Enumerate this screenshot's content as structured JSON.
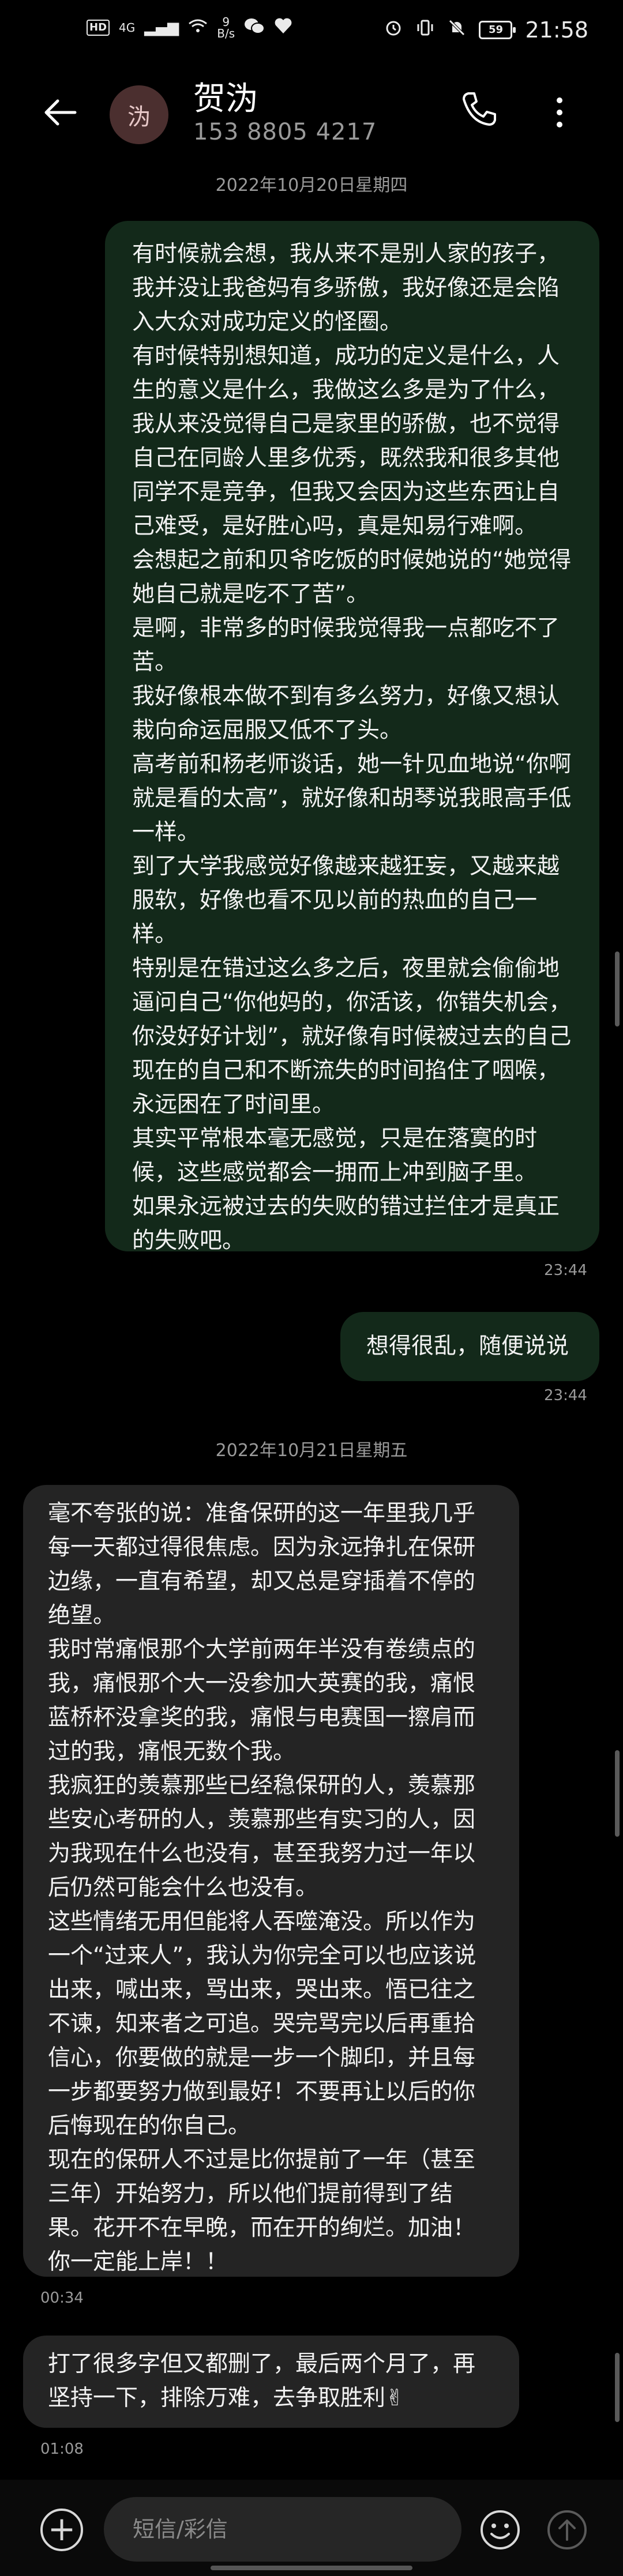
{
  "status_bar": {
    "hd_badge": "HD",
    "network": "4G",
    "speed_value": "9",
    "speed_unit": "B/s",
    "battery": "59",
    "time": "21:58"
  },
  "header": {
    "avatar_char": "沩",
    "contact_name": "贺沩",
    "contact_number": "153 8805 4217"
  },
  "messages": [
    {
      "type": "date",
      "text": "2022年10月20日星期四"
    },
    {
      "type": "out",
      "text": "有时候就会想，我从来不是别人家的孩子，我并没让我爸妈有多骄傲，我好像还是会陷入大众对成功定义的怪圈。\n有时候特别想知道，成功的定义是什么，人生的意义是什么，我做这么多是为了什么，我从来没觉得自己是家里的骄傲，也不觉得自己在同龄人里多优秀，既然我和很多其他同学不是竞争，但我又会因为这些东西让自己难受，是好胜心吗，真是知易行难啊。\n会想起之前和贝爷吃饭的时候她说的“她觉得她自己就是吃不了苦”。\n是啊，非常多的时候我觉得我一点都吃不了苦。\n我好像根本做不到有多么努力，好像又想认栽向命运屈服又低不了头。\n高考前和杨老师谈话，她一针见血地说“你啊就是看的太高”，就好像和胡琴说我眼高手低一样。\n到了大学我感觉好像越来越狂妄，又越来越服软，好像也看不见以前的热血的自己一样。\n特别是在错过这么多之后，夜里就会偷偷地逼问自己“你他妈的，你活该，你错失机会，你没好好计划”，就好像有时候被过去的自己现在的自己和不断流失的时间掐住了咽喉，永远困在了时间里。\n其实平常根本毫无感觉，只是在落寞的时候，这些感觉都会一拥而上冲到脑子里。\n如果永远被过去的失败的错过拦住才是真正的失败吧。",
      "time": "23:44"
    },
    {
      "type": "out",
      "text": "想得很乱，随便说说",
      "time": "23:44"
    },
    {
      "type": "date",
      "text": "2022年10月21日星期五"
    },
    {
      "type": "in",
      "text": "毫不夸张的说：准备保研的这一年里我几乎每一天都过得很焦虑。因为永远挣扎在保研边缘，一直有希望，却又总是穿插着不停的绝望。\n我时常痛恨那个大学前两年半没有卷绩点的我，痛恨那个大一没参加大英赛的我，痛恨蓝桥杯没拿奖的我，痛恨与电赛国一擦肩而过的我，痛恨无数个我。\n我疯狂的羡慕那些已经稳保研的人，羡慕那些安心考研的人，羡慕那些有实习的人，因为我现在什么也没有，甚至我努力过一年以后仍然可能会什么也没有。\n这些情绪无用但能将人吞噬淹没。所以作为一个“过来人”，我认为你完全可以也应该说出来，喊出来，骂出来，哭出来。悟已往之不谏，知来者之可追。哭完骂完以后再重拾信心，你要做的就是一步一个脚印，并且每一步都要努力做到最好！不要再让以后的你后悔现在的你自己。\n现在的保研人不过是比你提前了一年（甚至三年）开始努力，所以他们提前得到了结果。花开不在早晚，而在开的绚烂。加油！你一定能上岸！！",
      "time": "00:34"
    },
    {
      "type": "in",
      "text": "打了很多字但又都删了，最后两个月了，再坚持一下，排除万难，去争取胜利✌",
      "time": "01:08"
    }
  ],
  "composer": {
    "placeholder": "短信/彩信"
  },
  "icons": {
    "back": "back-arrow-icon",
    "call": "phone-icon",
    "more": "more-vertical-icon",
    "add": "plus-icon",
    "emoji": "smiley-icon",
    "send": "send-arrow-icon"
  }
}
